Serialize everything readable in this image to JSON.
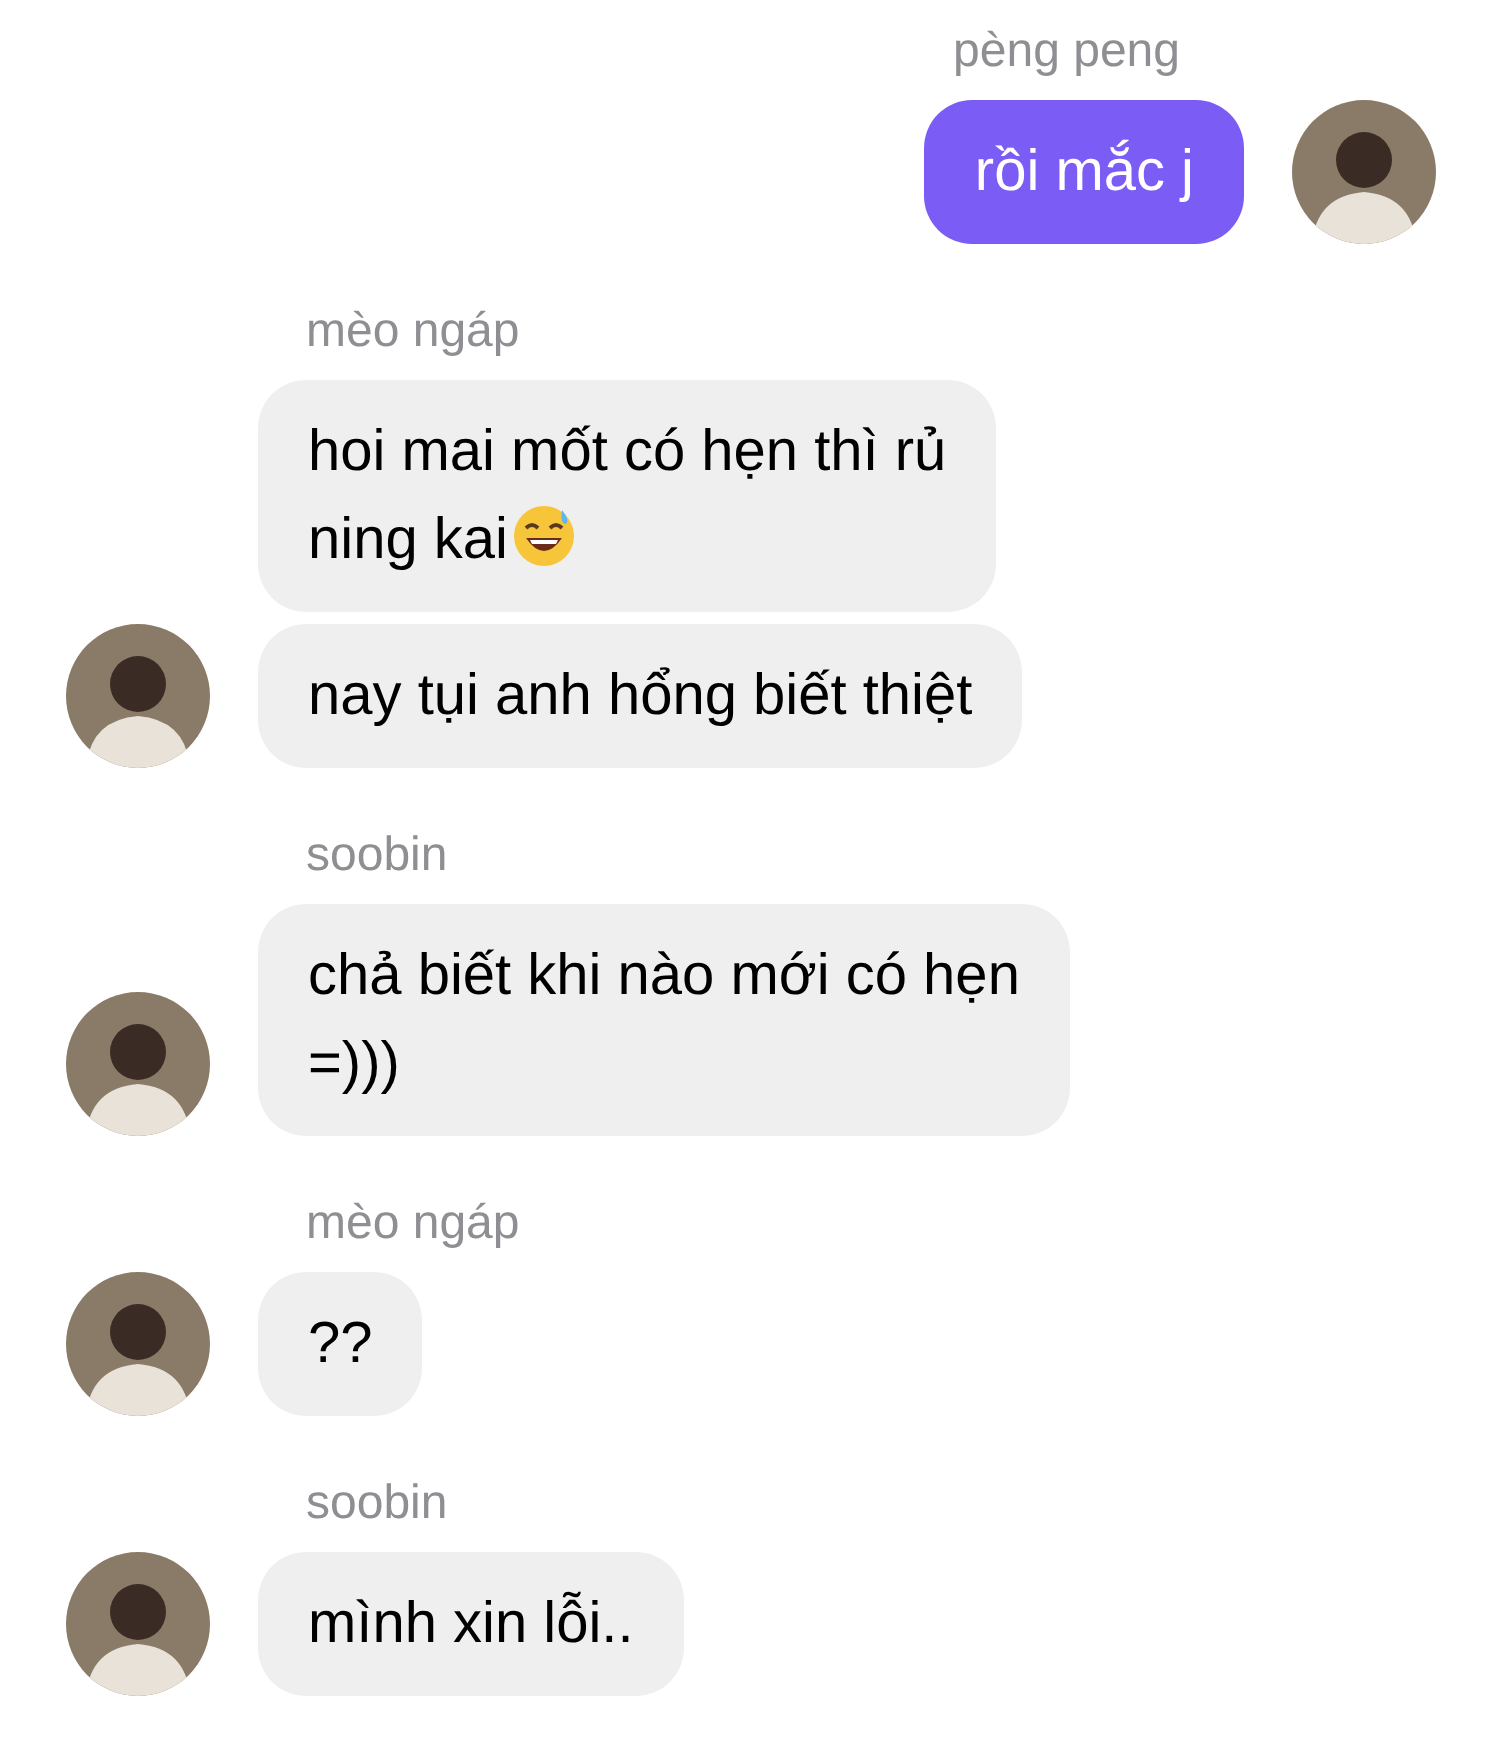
{
  "messages": [
    {
      "sender": "pèng peng",
      "kind": "outgoing",
      "bubbles": [
        {
          "text": "rồi mắc j"
        }
      ]
    },
    {
      "sender": "mèo ngáp",
      "kind": "incoming",
      "bubbles": [
        {
          "text": "hoi mai mốt có hẹn thì rủ\nning kai",
          "emoji_after": true
        },
        {
          "text": "nay tụi anh hổng biết thiệt"
        }
      ]
    },
    {
      "sender": "soobin",
      "kind": "incoming",
      "bubbles": [
        {
          "text": "chả biết khi nào mới có hẹn\n=)))"
        }
      ]
    },
    {
      "sender": "mèo ngáp",
      "kind": "incoming",
      "bubbles": [
        {
          "text": "??"
        }
      ]
    },
    {
      "sender": "soobin",
      "kind": "incoming",
      "bubbles": [
        {
          "text": "mình xin lỗi.."
        }
      ]
    }
  ]
}
